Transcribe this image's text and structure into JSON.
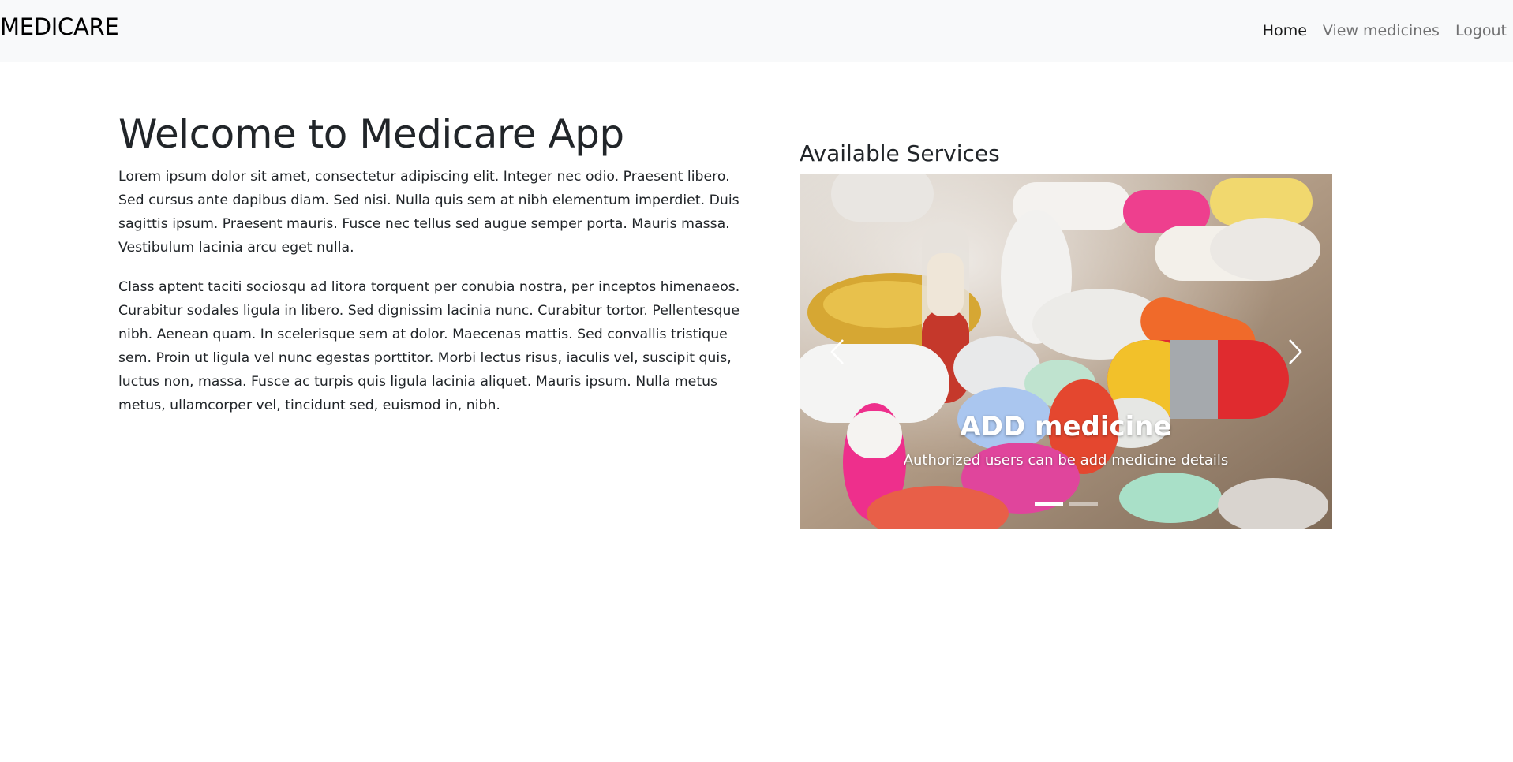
{
  "navbar": {
    "brand": "MEDICARE",
    "links": [
      {
        "label": "Home",
        "active": true
      },
      {
        "label": "View medicines",
        "active": false
      },
      {
        "label": "Logout",
        "active": false
      }
    ]
  },
  "main": {
    "title": "Welcome to Medicare App",
    "paragraphs": [
      "Lorem ipsum dolor sit amet, consectetur adipiscing elit. Integer nec odio. Praesent libero. Sed cursus ante dapibus diam. Sed nisi. Nulla quis sem at nibh elementum imperdiet. Duis sagittis ipsum. Praesent mauris. Fusce nec tellus sed augue semper porta. Mauris massa. Vestibulum lacinia arcu eget nulla.",
      "Class aptent taciti sociosqu ad litora torquent per conubia nostra, per inceptos himenaeos. Curabitur sodales ligula in libero. Sed dignissim lacinia nunc. Curabitur tortor. Pellentesque nibh. Aenean quam. In scelerisque sem at dolor. Maecenas mattis. Sed convallis tristique sem. Proin ut ligula vel nunc egestas porttitor. Morbi lectus risus, iaculis vel, suscipit quis, luctus non, massa. Fusce ac turpis quis ligula lacinia aliquet. Mauris ipsum. Nulla metus metus, ullamcorper vel, tincidunt sed, euismod in, nibh."
    ]
  },
  "services": {
    "title": "Available Services",
    "carousel": {
      "image": "pills-photo",
      "caption_title": "ADD medicine",
      "caption_text": "Authorized users can be add medicine details",
      "slide_count": 2,
      "active_slide": 1,
      "prev_icon": "chevron-left-icon",
      "next_icon": "chevron-right-icon"
    }
  },
  "colors": {
    "navbar_bg": "#f8f9fa",
    "text": "#212529",
    "nav_active": "#000000e6",
    "nav_inactive": "#0000008c"
  }
}
